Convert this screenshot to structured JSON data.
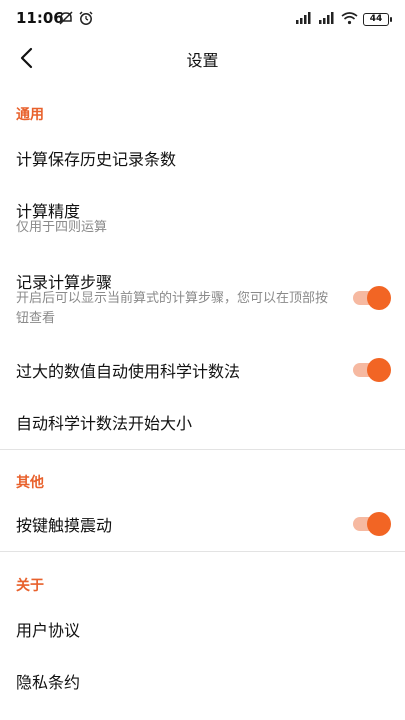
{
  "status_bar": {
    "time": "11:06",
    "battery": "44",
    "accent": "#111111"
  },
  "header": {
    "title": "设置"
  },
  "sections": {
    "general": {
      "header": "通用",
      "calc_history": {
        "title": "计算保存历史记录条数"
      },
      "precision": {
        "title": "计算精度",
        "subtitle": "仅用于四则运算"
      },
      "record_steps": {
        "title": "记录计算步骤",
        "subtitle": "开启后可以显示当前算式的计算步骤，您可以在顶部按钮查看",
        "enabled": true
      },
      "sci_notation": {
        "title": "过大的数值自动使用科学计数法",
        "enabled": true
      },
      "sci_threshold": {
        "title": "自动科学计数法开始大小"
      }
    },
    "other": {
      "header": "其他",
      "haptic": {
        "title": "按键触摸震动",
        "enabled": true
      }
    },
    "about": {
      "header": "关于",
      "user_agreement": {
        "title": "用户协议"
      },
      "privacy": {
        "title": "隐私条约"
      }
    }
  },
  "colors": {
    "accent": "#e8612c",
    "toggle_on": "#f26524",
    "toggle_track": "#f6b9a1"
  }
}
